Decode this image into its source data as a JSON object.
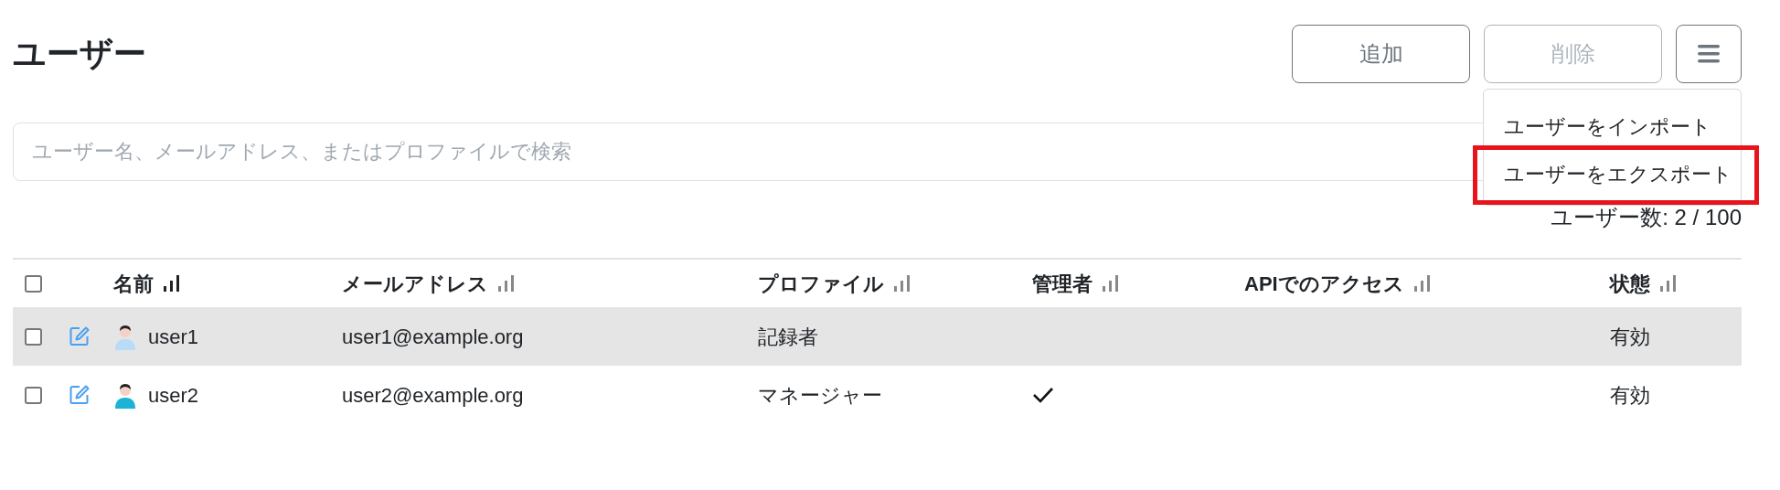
{
  "title": "ユーザー",
  "buttons": [
    {
      "label": "追加",
      "disabled": false
    },
    {
      "label": "削除",
      "disabled": true
    }
  ],
  "menu": {
    "items": [
      {
        "label": "ユーザーをインポート",
        "highlighted": false
      },
      {
        "label": "ユーザーをエクスポート",
        "highlighted": true
      }
    ]
  },
  "search": {
    "placeholder": "ユーザー名、メールアドレス、またはプロファイルで検索"
  },
  "count": "ユーザー数: 2 / 100",
  "table": {
    "select_all": {
      "checked": false
    },
    "columns": [
      {
        "label": "名前",
        "sorted": true
      },
      {
        "label": "メールアドレス",
        "sorted": false
      },
      {
        "label": "プロファイル",
        "sorted": false
      },
      {
        "label": "管理者",
        "sorted": false
      },
      {
        "label": "APIでのアクセス",
        "sorted": false
      },
      {
        "label": "状態",
        "sorted": false
      }
    ],
    "rows": [
      {
        "checked": false,
        "selected": true,
        "name": "user1",
        "color": "#b7dcf5",
        "email": "user1@example.org",
        "profile": "記録者",
        "admin": false,
        "api": false,
        "status": "有効"
      },
      {
        "checked": false,
        "selected": false,
        "name": "user2",
        "color": "#1bb4d6",
        "email": "user2@example.org",
        "profile": "マネージャー",
        "admin": true,
        "api": false,
        "status": "有効"
      }
    ]
  }
}
